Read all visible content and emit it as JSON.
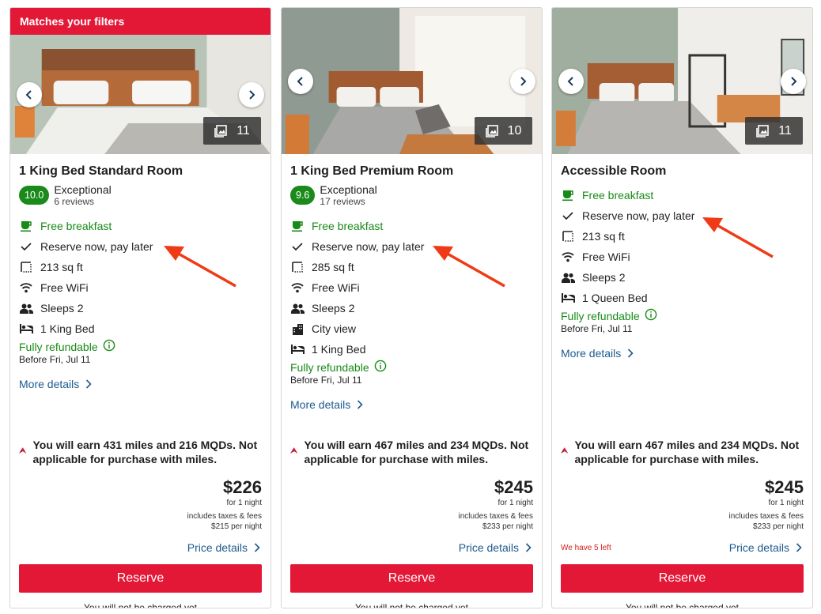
{
  "colors": {
    "brand_red": "#e31837",
    "green": "#178a17",
    "link_blue": "#1d5a8e",
    "annotation_arrow": "#f03a16"
  },
  "cards": [
    {
      "banner": "Matches your filters",
      "photo_count": "11",
      "room_name": "1 King Bed Standard Room",
      "rating": {
        "score": "10.0",
        "label": "Exceptional",
        "reviews": "6 reviews"
      },
      "features": [
        {
          "icon": "coffee-cup-icon",
          "text": "Free breakfast",
          "green": true
        },
        {
          "icon": "check-icon",
          "text": "Reserve now, pay later"
        },
        {
          "icon": "square-footage-icon",
          "text": "213 sq ft"
        },
        {
          "icon": "wifi-icon",
          "text": "Free WiFi"
        },
        {
          "icon": "people-icon",
          "text": "Sleeps 2"
        },
        {
          "icon": "bed-icon",
          "text": "1 King Bed"
        }
      ],
      "refund": {
        "label": "Fully refundable",
        "date": "Before Fri, Jul 11"
      },
      "more_details": "More details",
      "miles": "You will earn 431 miles and 216 MQDs. Not applicable for purchase with miles.",
      "price": "$226",
      "per": "for 1 night",
      "taxes": "includes taxes & fees",
      "per_night": "$215 per night",
      "rooms_left": "",
      "price_details": "Price details",
      "reserve": "Reserve",
      "no_charge": "You will not be charged yet"
    },
    {
      "banner": "",
      "photo_count": "10",
      "room_name": "1 King Bed Premium Room",
      "rating": {
        "score": "9.6",
        "label": "Exceptional",
        "reviews": "17 reviews"
      },
      "features": [
        {
          "icon": "coffee-cup-icon",
          "text": "Free breakfast",
          "green": true
        },
        {
          "icon": "check-icon",
          "text": "Reserve now, pay later"
        },
        {
          "icon": "square-footage-icon",
          "text": "285 sq ft"
        },
        {
          "icon": "wifi-icon",
          "text": "Free WiFi"
        },
        {
          "icon": "people-icon",
          "text": "Sleeps 2"
        },
        {
          "icon": "city-icon",
          "text": "City view"
        },
        {
          "icon": "bed-icon",
          "text": "1 King Bed"
        }
      ],
      "refund": {
        "label": "Fully refundable",
        "date": "Before Fri, Jul 11"
      },
      "more_details": "More details",
      "miles": "You will earn 467 miles and 234 MQDs. Not applicable for purchase with miles.",
      "price": "$245",
      "per": "for 1 night",
      "taxes": "includes taxes & fees",
      "per_night": "$233 per night",
      "rooms_left": "",
      "price_details": "Price details",
      "reserve": "Reserve",
      "no_charge": "You will not be charged yet"
    },
    {
      "banner": "",
      "photo_count": "11",
      "room_name": "Accessible Room",
      "rating": null,
      "features": [
        {
          "icon": "coffee-cup-icon",
          "text": "Free breakfast",
          "green": true
        },
        {
          "icon": "check-icon",
          "text": "Reserve now, pay later"
        },
        {
          "icon": "square-footage-icon",
          "text": "213 sq ft"
        },
        {
          "icon": "wifi-icon",
          "text": "Free WiFi"
        },
        {
          "icon": "people-icon",
          "text": "Sleeps 2"
        },
        {
          "icon": "bed-icon",
          "text": "1 Queen Bed"
        }
      ],
      "refund": {
        "label": "Fully refundable",
        "date": "Before Fri, Jul 11"
      },
      "more_details": "More details",
      "miles": "You will earn 467 miles and 234 MQDs. Not applicable for purchase with miles.",
      "price": "$245",
      "per": "for 1 night",
      "taxes": "includes taxes & fees",
      "per_night": "$233 per night",
      "rooms_left": "We have 5 left",
      "price_details": "Price details",
      "reserve": "Reserve",
      "no_charge": "You will not be charged yet"
    }
  ]
}
